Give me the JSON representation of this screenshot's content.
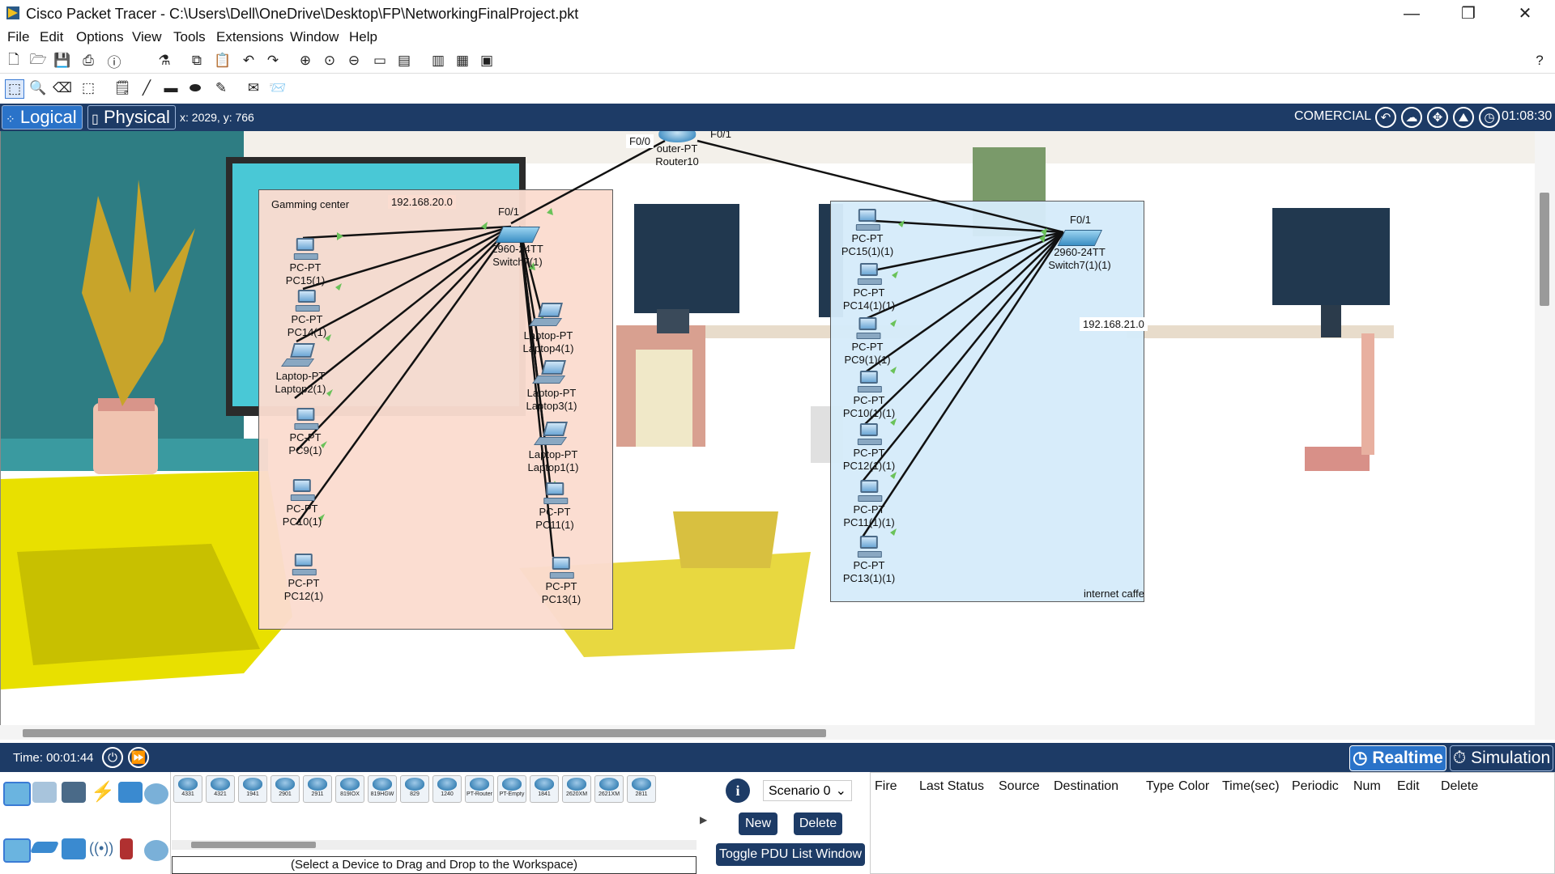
{
  "window": {
    "title": "Cisco Packet Tracer - C:\\Users\\Dell\\OneDrive\\Desktop\\FP\\NetworkingFinalProject.pkt",
    "minimize_glyph": "—",
    "maximize_glyph": "❐",
    "close_glyph": "✕"
  },
  "menu": [
    "File",
    "Edit",
    "Options",
    "View",
    "Tools",
    "Extensions",
    "Window",
    "Help"
  ],
  "toolbar1_icons": [
    "new-icon",
    "open-icon",
    "save-icon",
    "print-icon",
    "info-icon",
    "wizard-icon",
    "copy-icon",
    "paste-icon",
    "undo-icon",
    "redo-icon",
    "zoom-in-icon",
    "zoom-reset-icon",
    "zoom-out-icon",
    "drawing-palette-icon",
    "custom-device-icon",
    "viewport-icon",
    "ipc-icon",
    "web-icon"
  ],
  "toolbar2_icons": [
    "select-icon",
    "inspect-icon",
    "delete-icon",
    "resize-icon",
    "note-icon",
    "line-icon",
    "rectangle-icon",
    "ellipse-icon",
    "freeform-icon",
    "simple-pdu-icon",
    "complex-pdu-icon"
  ],
  "help_glyph": "?",
  "modebar": {
    "logical": "Logical",
    "physical": "Physical",
    "coords": "x: 2029, y: 766",
    "environment": "COMERCIAL",
    "clock": "01:08:30"
  },
  "topology": {
    "router": {
      "type": "outer-PT",
      "name": "Router10",
      "port_left": "F0/0",
      "port_right": "F0/1"
    },
    "left_area": {
      "title": "Gamming center",
      "network": "192.168.20.0",
      "switch": {
        "port": "F0/1",
        "type": "2960-24TT",
        "name": "Switch7(1)"
      },
      "devices": [
        {
          "type": "PC-PT",
          "name": "PC15(1)",
          "kind": "pc"
        },
        {
          "type": "PC-PT",
          "name": "PC14(1)",
          "kind": "pc"
        },
        {
          "type": "Laptop-PT",
          "name": "Laptop2(1)",
          "kind": "laptop"
        },
        {
          "type": "PC-PT",
          "name": "PC9(1)",
          "kind": "pc"
        },
        {
          "type": "PC-PT",
          "name": "PC10(1)",
          "kind": "pc"
        },
        {
          "type": "PC-PT",
          "name": "PC12(1)",
          "kind": "pc"
        },
        {
          "type": "Laptop-PT",
          "name": "Laptop4(1)",
          "kind": "laptop"
        },
        {
          "type": "Laptop-PT",
          "name": "Laptop3(1)",
          "kind": "laptop"
        },
        {
          "type": "Laptop-PT",
          "name": "Laptop1(1)",
          "kind": "laptop"
        },
        {
          "type": "PC-PT",
          "name": "PC11(1)",
          "kind": "pc"
        },
        {
          "type": "PC-PT",
          "name": "PC13(1)",
          "kind": "pc"
        }
      ]
    },
    "right_area": {
      "title": "internet caffe",
      "network": "192.168.21.0",
      "switch": {
        "port": "F0/1",
        "type": "2960-24TT",
        "name": "Switch7(1)(1)"
      },
      "devices": [
        {
          "type": "PC-PT",
          "name": "PC15(1)(1)",
          "kind": "pc"
        },
        {
          "type": "PC-PT",
          "name": "PC14(1)(1)",
          "kind": "pc"
        },
        {
          "type": "PC-PT",
          "name": "PC9(1)(1)",
          "kind": "pc"
        },
        {
          "type": "PC-PT",
          "name": "PC10(1)(1)",
          "kind": "pc"
        },
        {
          "type": "PC-PT",
          "name": "PC12(1)(1)",
          "kind": "pc"
        },
        {
          "type": "PC-PT",
          "name": "PC11(1)(1)",
          "kind": "pc"
        },
        {
          "type": "PC-PT",
          "name": "PC13(1)(1)",
          "kind": "pc"
        }
      ]
    }
  },
  "timebar": {
    "time": "Time: 00:01:44",
    "realtime": "Realtime",
    "simulation": "Simulation"
  },
  "device_models": [
    "4331",
    "4321",
    "1941",
    "2901",
    "2911",
    "819IOX",
    "819HGW",
    "829",
    "1240",
    "PT-Router",
    "PT-Empty",
    "1841",
    "2620XM",
    "2621XM",
    "2811"
  ],
  "device_hint": "(Select a Device to Drag and Drop to the Workspace)",
  "scenario": {
    "selected": "Scenario 0",
    "new": "New",
    "delete": "Delete",
    "toggle": "Toggle PDU List Window"
  },
  "pdu_columns": [
    "Fire",
    "Last Status",
    "Source",
    "Destination",
    "Type",
    "Color",
    "Time(sec)",
    "Periodic",
    "Num",
    "Edit",
    "Delete"
  ],
  "colors": {
    "modebar": "#1d3b66",
    "left_area": "#fbdcd0",
    "right_area": "#d6ecfa",
    "link_up": "#6ac259"
  }
}
